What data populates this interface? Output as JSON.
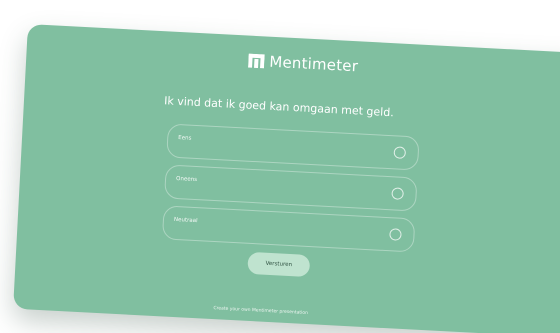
{
  "brand": {
    "name": "Mentimeter",
    "logo_icon": "mentimeter-logo-icon"
  },
  "question": "Ik vind dat ik goed kan omgaan met geld.",
  "options": [
    {
      "label": "Eens"
    },
    {
      "label": "Oneens"
    },
    {
      "label": "Neutraal"
    }
  ],
  "submit_label": "Versturen",
  "footer": "Create your own Mentimeter presentation",
  "colors": {
    "background": "#80bfa0",
    "button": "#bfe3cf",
    "button_text": "#2f5141",
    "text": "#ffffff"
  }
}
